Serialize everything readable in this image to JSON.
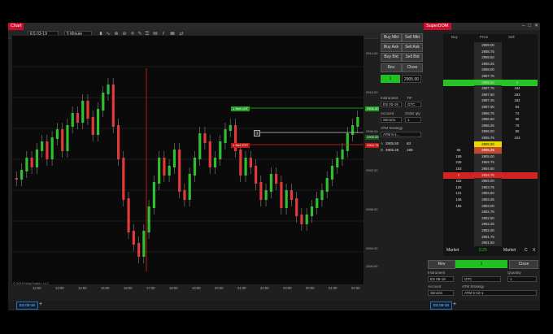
{
  "chart_window": {
    "title": "Chart",
    "instrument": "ES 03-19",
    "interval": "5 Minute",
    "y_ticks": [
      "2914.00",
      "2910.00",
      "2906.00",
      "2902.00",
      "2898.00",
      "2894.00",
      "2890.00"
    ],
    "x_ticks": [
      "12:00",
      "13:00",
      "14:00",
      "15:00",
      "16:00",
      "17:00",
      "18:00",
      "19:00",
      "20:00",
      "21:00",
      "22:00",
      "23:00",
      "00:00",
      "01:00",
      "02:00"
    ],
    "copyright": "© 2019 NinjaTrader, LLC",
    "tab": "ES 03-19",
    "last_price_label": "2905.00",
    "order_lines": [
      {
        "label": "1 Sell LMT",
        "price_label": "2906.50",
        "color": "#22c022"
      },
      {
        "label": "1",
        "price_label": "",
        "color": "#c8c8c8"
      },
      {
        "label": "1 Sell STP",
        "price_label": "2904.75",
        "color": "#e02020"
      }
    ]
  },
  "chart_trader": {
    "buttons": {
      "buy_mkt": "Buy Mkt",
      "sell_mkt": "Sell Mkt",
      "buy_ask": "Buy Ask",
      "sell_ask": "Sell Ask",
      "buy_bid": "Buy Bid",
      "sell_bid": "Sell Bid",
      "rev": "Rev",
      "close": "Close"
    },
    "position_qty": "1",
    "position_price": "2905.00",
    "instrument_label": "Instrument",
    "tif_label": "TIF",
    "instrument_value": "ES 03-19",
    "tif_value": "GTC",
    "account_label": "Account",
    "order_qty_label": "Order qty",
    "account_value": "Sim101",
    "order_qty_value": "1",
    "atm_label": "ATM Strategy",
    "atm_value": "ATM 5-1...",
    "a_label": "A",
    "a_price": "2905.50",
    "a_size": "63",
    "b_label": "B",
    "b_price": "2905.25",
    "b_size": "189"
  },
  "superdom": {
    "title": "SuperDOM",
    "headers": {
      "buy": "Buy",
      "price": "Price",
      "sell": "Sell"
    },
    "rows": [
      {
        "buy": "",
        "price": "2909.00",
        "sell": ""
      },
      {
        "buy": "",
        "price": "2908.75",
        "sell": ""
      },
      {
        "buy": "",
        "price": "2908.50",
        "sell": ""
      },
      {
        "buy": "",
        "price": "2908.25",
        "sell": ""
      },
      {
        "buy": "",
        "price": "2908.00",
        "sell": ""
      },
      {
        "buy": "",
        "price": "2907.75",
        "sell": ""
      },
      {
        "buy": "",
        "price": "2906.50",
        "sell": "1"
      },
      {
        "buy": "",
        "price": "2907.75",
        "sell": "184"
      },
      {
        "buy": "",
        "price": "2907.50",
        "sell": "193"
      },
      {
        "buy": "",
        "price": "2907.25",
        "sell": "182"
      },
      {
        "buy": "",
        "price": "2907.00",
        "sell": "94"
      },
      {
        "buy": "",
        "price": "2906.75",
        "sell": "74"
      },
      {
        "buy": "",
        "price": "2906.50",
        "sell": "95"
      },
      {
        "buy": "",
        "price": "2906.25",
        "sell": "76"
      },
      {
        "buy": "",
        "price": "2906.00",
        "sell": "80"
      },
      {
        "buy": "",
        "price": "2905.75",
        "sell": "103"
      },
      {
        "buy": "",
        "price": "2905.50",
        "sell": ""
      },
      {
        "buy": "65",
        "price": "2905.25",
        "sell": ""
      },
      {
        "buy": "189",
        "price": "2905.00",
        "sell": ""
      },
      {
        "buy": "236",
        "price": "2904.75",
        "sell": ""
      },
      {
        "buy": "153",
        "price": "2904.50",
        "sell": ""
      },
      {
        "buy": "1",
        "price": "2904.75",
        "sell": ""
      },
      {
        "buy": "115",
        "price": "2904.00",
        "sell": ""
      },
      {
        "buy": "125",
        "price": "2903.75",
        "sell": ""
      },
      {
        "buy": "131",
        "price": "2903.50",
        "sell": ""
      },
      {
        "buy": "136",
        "price": "2903.25",
        "sell": ""
      },
      {
        "buy": "155",
        "price": "2903.00",
        "sell": ""
      },
      {
        "buy": "",
        "price": "2902.75",
        "sell": ""
      },
      {
        "buy": "",
        "price": "2902.50",
        "sell": ""
      },
      {
        "buy": "",
        "price": "2902.25",
        "sell": ""
      },
      {
        "buy": "",
        "price": "2902.00",
        "sell": ""
      },
      {
        "buy": "",
        "price": "2901.75",
        "sell": ""
      },
      {
        "buy": "",
        "price": "2901.50",
        "sell": ""
      }
    ],
    "market_left": "Market",
    "position_value": "0.25",
    "market_right": "Market",
    "c_label": "C",
    "x_label": "X",
    "rev": "Rev",
    "position_qty": "1",
    "close": "Close",
    "instrument_label": "Instrument",
    "quantity_label": "Quantity",
    "instrument_value": "ES 06-19",
    "tif_value": "GTC",
    "quantity_value": "1",
    "account_label": "Account",
    "atm_label": "ATM Strategy",
    "account_value": "Sim101",
    "atm_value": "ATM 5-10-1",
    "tab": "ES 06-19"
  },
  "colors": {
    "up": "#2fbf2f",
    "down": "#e23a3a",
    "accent": "#c8102e"
  }
}
